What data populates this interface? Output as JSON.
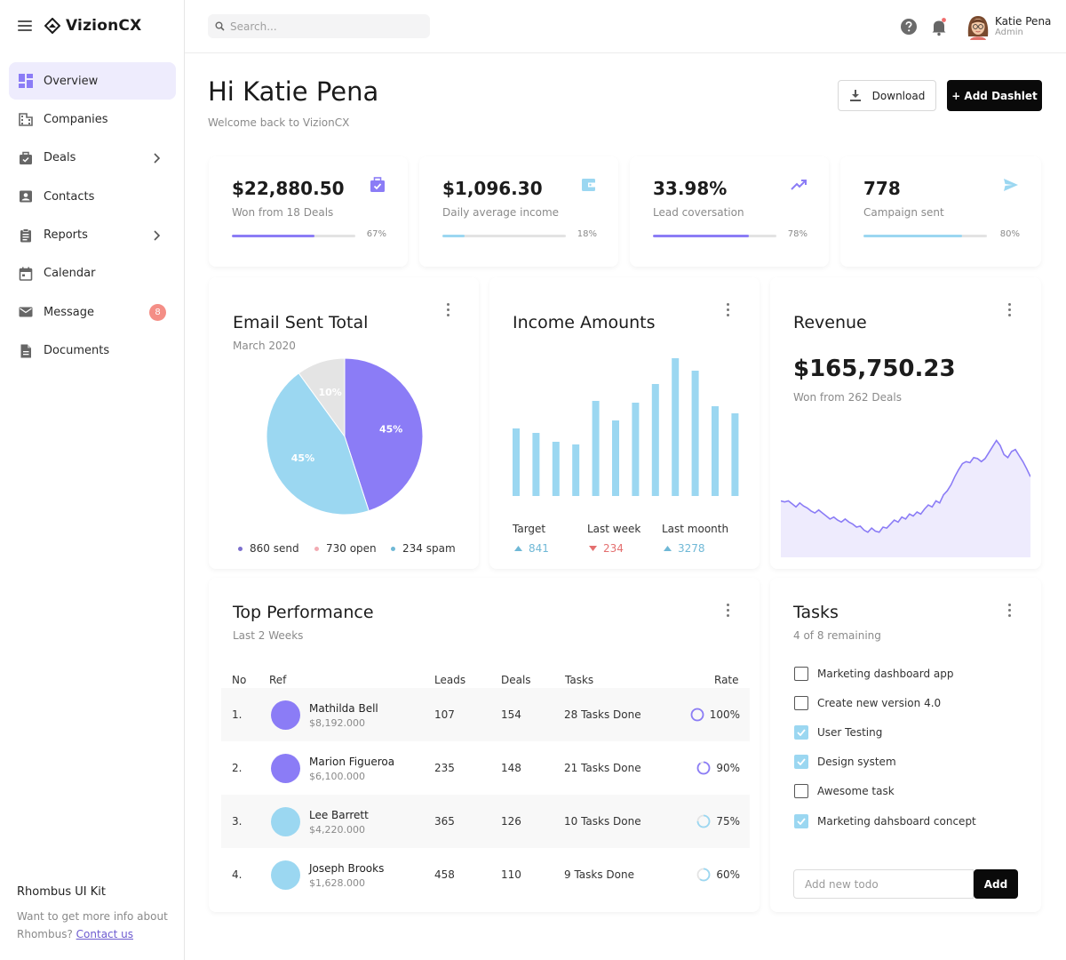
{
  "app": {
    "name": "VizionCX"
  },
  "sidebar": {
    "items": [
      {
        "label": "Overview",
        "icon": "dashboard-icon",
        "active": true
      },
      {
        "label": "Companies",
        "icon": "building-icon"
      },
      {
        "label": "Deals",
        "icon": "briefcase-icon",
        "chevron": true
      },
      {
        "label": "Contacts",
        "icon": "contact-card-icon"
      },
      {
        "label": "Reports",
        "icon": "clipboard-icon",
        "chevron": true
      },
      {
        "label": "Calendar",
        "icon": "calendar-icon"
      },
      {
        "label": "Message",
        "icon": "mail-icon",
        "badge": "8"
      },
      {
        "label": "Documents",
        "icon": "document-icon"
      }
    ],
    "promo": {
      "title": "Rhombus UI Kit",
      "text": "Want to get more info about Rhombus?",
      "link": "Contact us"
    }
  },
  "topbar": {
    "search_placeholder": "Search...",
    "user": {
      "name": "Katie Pena",
      "role": "Admin"
    }
  },
  "header": {
    "greeting": "Hi Katie Pena",
    "subtitle": "Welcome back to VizionCX",
    "download_label": "Download",
    "add_label": "+ Add Dashlet"
  },
  "stats": [
    {
      "value": "$22,880.50",
      "label": "Won from 18 Deals",
      "percent": 67,
      "percent_label": "67%",
      "color": "#8b7cf6",
      "icon": "briefcase-check-icon"
    },
    {
      "value": "$1,096.30",
      "label": "Daily average income",
      "percent": 18,
      "percent_label": "18%",
      "color": "#9bd7f1",
      "icon": "wallet-icon"
    },
    {
      "value": "33.98%",
      "label": "Lead coversation",
      "percent": 78,
      "percent_label": "78%",
      "color": "#8b7cf6",
      "icon": "trending-up-icon"
    },
    {
      "value": "778",
      "label": "Campaign sent",
      "percent": 80,
      "percent_label": "80%",
      "color": "#9bd7f1",
      "icon": "send-icon"
    }
  ],
  "email_card": {
    "title": "Email Sent Total",
    "subtitle": "March 2020",
    "chart_data": {
      "type": "pie",
      "slices": [
        {
          "label": "45%",
          "value": 45,
          "color": "#8b7cf6"
        },
        {
          "label": "45%",
          "value": 45,
          "color": "#9bd7f1"
        },
        {
          "label": "10%",
          "value": 10,
          "color": "#e4e4e4"
        }
      ]
    },
    "legend": [
      {
        "label": "860 send",
        "color": "#7c6fce"
      },
      {
        "label": "730 open",
        "color": "#f2aab2"
      },
      {
        "label": "234 spam",
        "color": "#6fb8d6"
      }
    ]
  },
  "income_card": {
    "title": "Income Amounts",
    "chart_data": {
      "type": "bar",
      "values": [
        76,
        71,
        61,
        58,
        107,
        85,
        105,
        126,
        155,
        141,
        101,
        93
      ],
      "color": "#9bd7f1"
    },
    "summary": [
      {
        "label": "Target",
        "value": "841",
        "trend": "up",
        "color": "#6fb8d6"
      },
      {
        "label": "Last week",
        "value": "234",
        "trend": "down",
        "color": "#e46f6f"
      },
      {
        "label": "Last moonth",
        "value": "3278",
        "trend": "up",
        "color": "#6fb8d6"
      }
    ]
  },
  "revenue_card": {
    "title": "Revenue",
    "value": "$165,750.23",
    "subtitle": "Won from 262 Deals",
    "chart_data": {
      "type": "area",
      "values": [
        56,
        55,
        56,
        53,
        50,
        54,
        51,
        49,
        46,
        44,
        47,
        44,
        41,
        38,
        40,
        37,
        35,
        38,
        35,
        33,
        30,
        31,
        27,
        25,
        29,
        26,
        25,
        30,
        29,
        33,
        37,
        35,
        40,
        38,
        43,
        41,
        45,
        43,
        48,
        52,
        50,
        56,
        54,
        62,
        66,
        72,
        80,
        87,
        93,
        95,
        94,
        99,
        98,
        95,
        98,
        104,
        110,
        116,
        111,
        102,
        99,
        105,
        107,
        101,
        95,
        88,
        80
      ],
      "stroke": "#8b7cf6",
      "fill": "#eeebfd"
    }
  },
  "performance": {
    "title": "Top Performance",
    "subtitle": "Last 2 Weeks",
    "columns": [
      "No",
      "Ref",
      "Leads",
      "Deals",
      "Tasks",
      "Rate"
    ],
    "rows": [
      {
        "no": "1.",
        "name": "Mathilda Bell",
        "amount": "$8,192.000",
        "leads": "107",
        "deals": "154",
        "tasks": "28 Tasks Done",
        "rate": "100%",
        "rate_value": 100,
        "avatar_color": "#8b7cf6",
        "ring_color": "#8b7cf6"
      },
      {
        "no": "2.",
        "name": "Marion Figueroa",
        "amount": "$6,100.000",
        "leads": "235",
        "deals": "148",
        "tasks": "21 Tasks Done",
        "rate": "90%",
        "rate_value": 90,
        "avatar_color": "#8b7cf6",
        "ring_color": "#8b7cf6"
      },
      {
        "no": "3.",
        "name": "Lee Barrett",
        "amount": "$4,220.000",
        "leads": "365",
        "deals": "126",
        "tasks": "10 Tasks Done",
        "rate": "75%",
        "rate_value": 75,
        "avatar_color": "#9bd7f1",
        "ring_color": "#9bd7f1"
      },
      {
        "no": "4.",
        "name": "Joseph Brooks",
        "amount": "$1,628.000",
        "leads": "458",
        "deals": "110",
        "tasks": "9 Tasks Done",
        "rate": "60%",
        "rate_value": 60,
        "avatar_color": "#9bd7f1",
        "ring_color": "#9bd7f1"
      }
    ]
  },
  "tasks": {
    "title": "Tasks",
    "subtitle": "4 of 8 remaining",
    "items": [
      {
        "label": "Marketing dashboard app",
        "done": false
      },
      {
        "label": "Create new version 4.0",
        "done": false
      },
      {
        "label": "User Testing",
        "done": true
      },
      {
        "label": "Design system",
        "done": true
      },
      {
        "label": "Awesome task",
        "done": false
      },
      {
        "label": "Marketing dahsboard concept",
        "done": true
      }
    ],
    "input_placeholder": "Add new todo",
    "add_label": "Add"
  }
}
